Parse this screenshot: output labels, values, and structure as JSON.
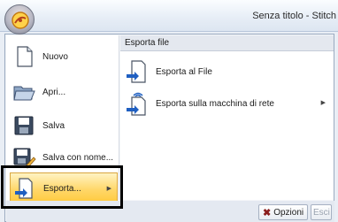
{
  "window": {
    "title": "Senza titolo - Stitch"
  },
  "menu": {
    "items": [
      {
        "label": "Nuovo",
        "icon": "new-document-icon"
      },
      {
        "label": "Apri...",
        "icon": "open-folder-icon"
      },
      {
        "label": "Salva",
        "icon": "save-icon"
      },
      {
        "label": "Salva con nome...",
        "icon": "save-as-icon"
      },
      {
        "label": "Esporta...",
        "icon": "export-icon"
      }
    ],
    "section_header": "Esporta file",
    "sub_items": [
      {
        "label": "Esporta al File",
        "icon": "export-to-file-icon"
      },
      {
        "label": "Esporta sulla macchina di rete",
        "icon": "export-network-machine-icon"
      }
    ],
    "options_button": "Opzioni",
    "exit_button": "Esci"
  },
  "colors": {
    "active_item": "#ffd768",
    "highlight_border": "#000000",
    "accent_blue": "#1f5fc1"
  }
}
